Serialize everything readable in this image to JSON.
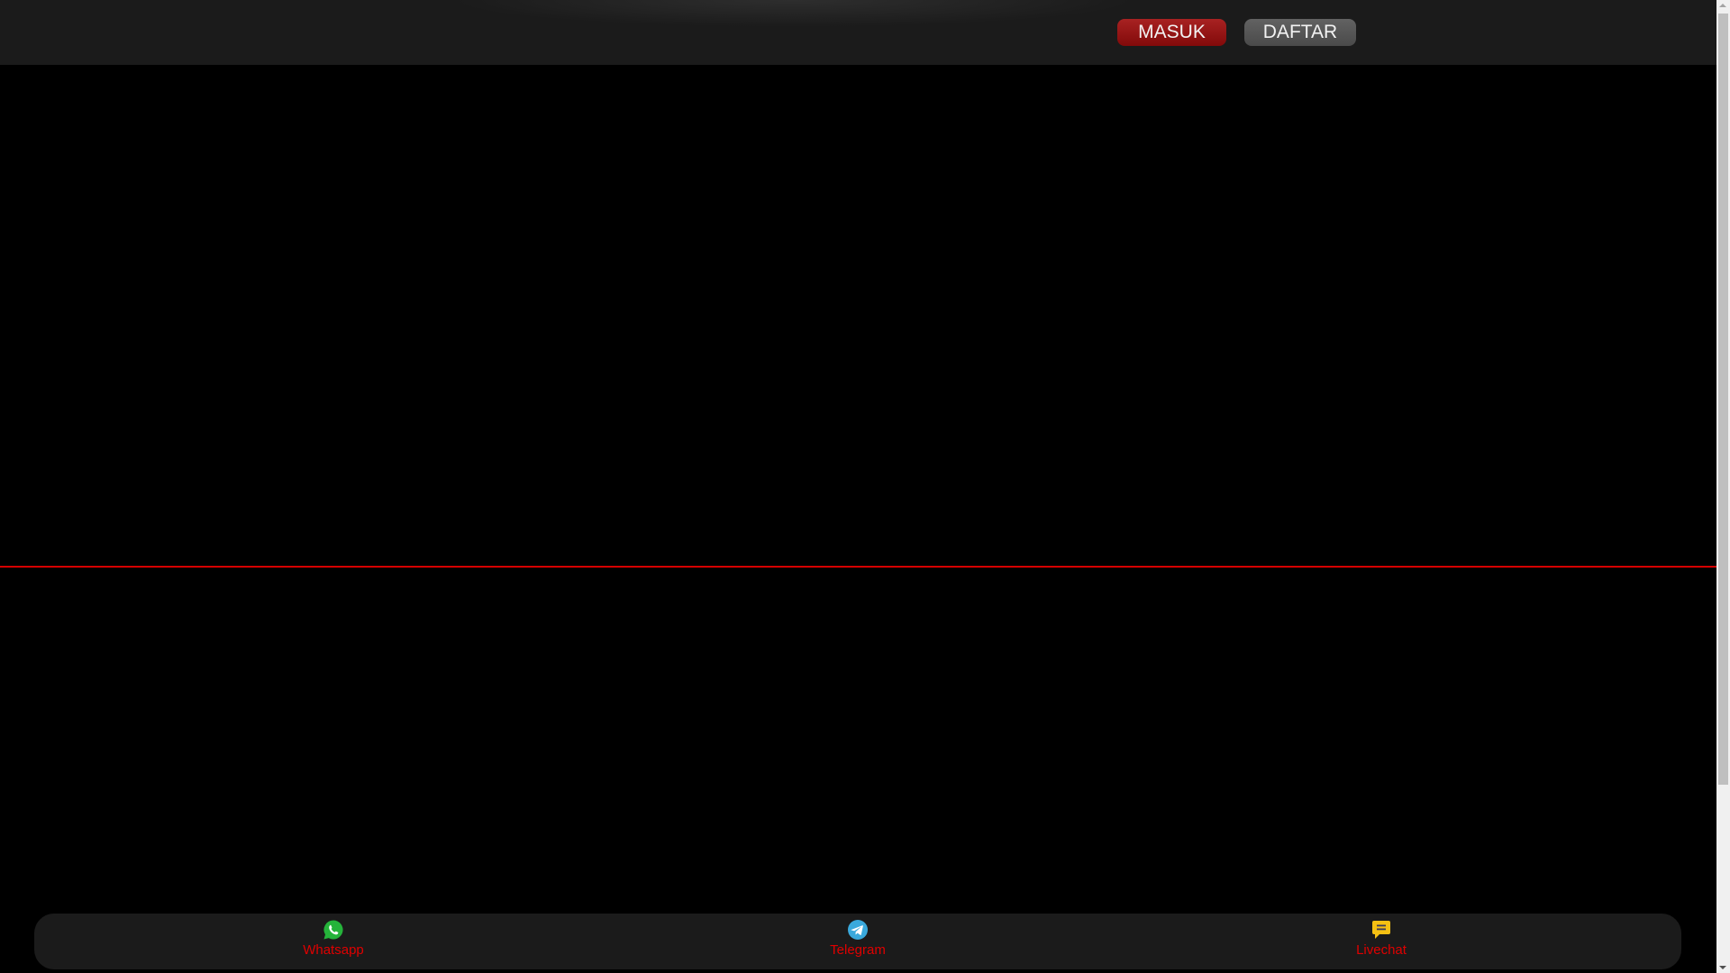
{
  "header": {
    "login_label": "MASUK",
    "register_label": "DAFTAR"
  },
  "bottom_nav": [
    {
      "label": "Whatsapp",
      "icon": "whatsapp-icon",
      "color": "#25b33a"
    },
    {
      "label": "Telegram",
      "icon": "telegram-icon",
      "color": "#3aa9dc"
    },
    {
      "label": "Livechat",
      "icon": "chat-bubble-icon",
      "color": "#f5c013"
    }
  ]
}
